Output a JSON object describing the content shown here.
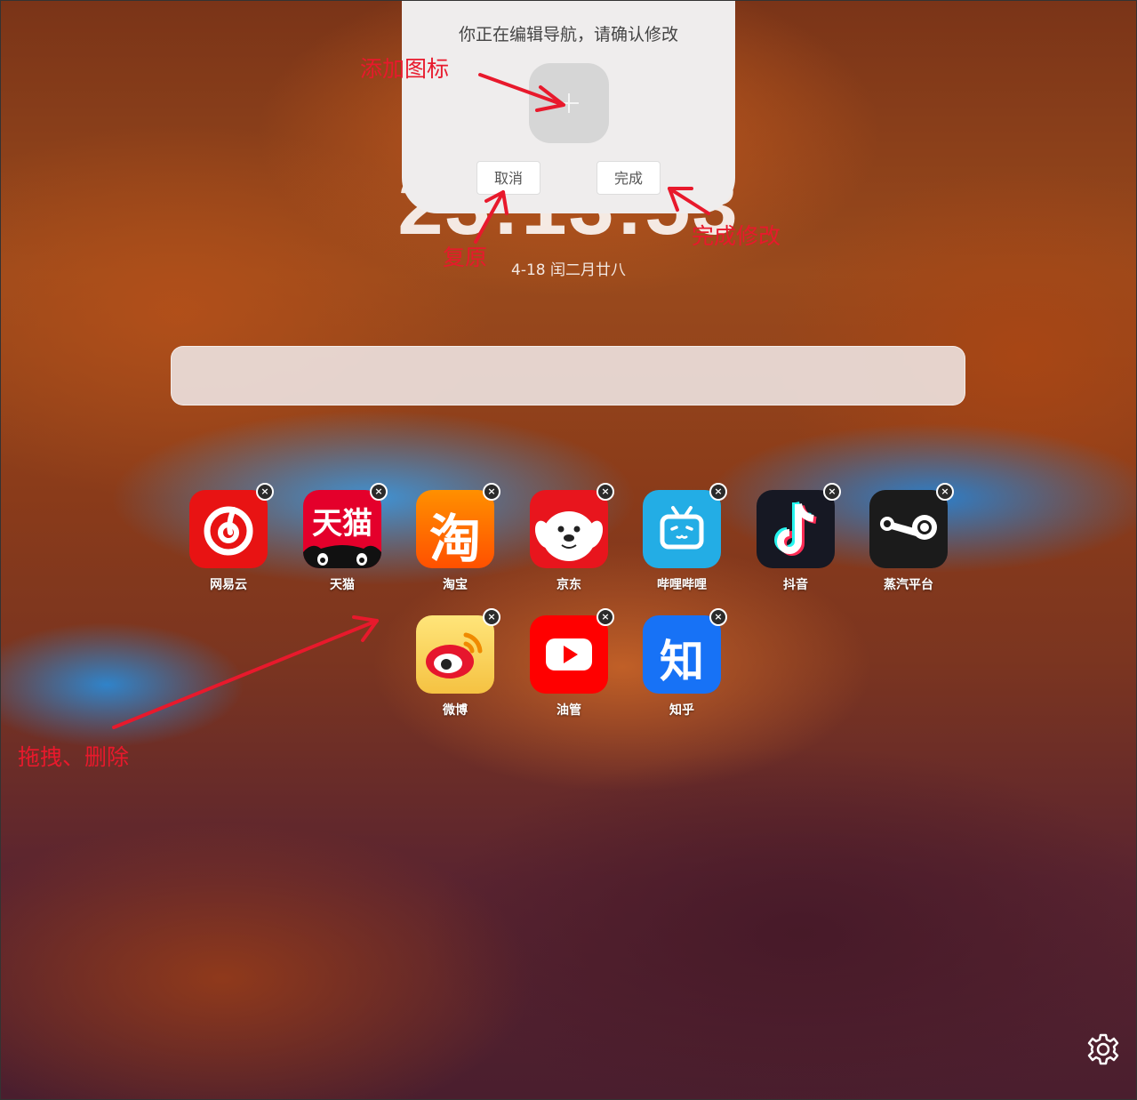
{
  "edit_panel": {
    "title": "你正在编辑导航，请确认修改",
    "cancel_label": "取消",
    "done_label": "完成"
  },
  "clock": {
    "time": "23:13:53",
    "date": "4-18 闰二月廿八"
  },
  "apps": [
    {
      "label": "网易云",
      "icon": "netease-music-icon",
      "color": "#e81313"
    },
    {
      "label": "天猫",
      "icon": "tmall-icon",
      "color": "#e4002b"
    },
    {
      "label": "淘宝",
      "icon": "taobao-icon",
      "color": "#ff6a00"
    },
    {
      "label": "京东",
      "icon": "jd-icon",
      "color": "#e8151d"
    },
    {
      "label": "哔哩哔哩",
      "icon": "bilibili-icon",
      "color": "#23ade5"
    },
    {
      "label": "抖音",
      "icon": "douyin-icon",
      "color": "#161823"
    },
    {
      "label": "蒸汽平台",
      "icon": "steam-icon",
      "color": "#1b1b1b"
    },
    {
      "label": "微博",
      "icon": "weibo-icon",
      "color": "#f7d358"
    },
    {
      "label": "油管",
      "icon": "youtube-icon",
      "color": "#ff0000"
    },
    {
      "label": "知乎",
      "icon": "zhihu-icon",
      "color": "#1772f6"
    }
  ],
  "tile_text": {
    "tmall": "天猫",
    "taobao": "淘",
    "zhihu": "知"
  },
  "delete_glyph": "×",
  "annotations": {
    "add_icon": "添加图标",
    "restore": "复原",
    "finish": "完成修改",
    "drag_delete": "拖拽、删除"
  },
  "annotation_color": "#e8192c"
}
